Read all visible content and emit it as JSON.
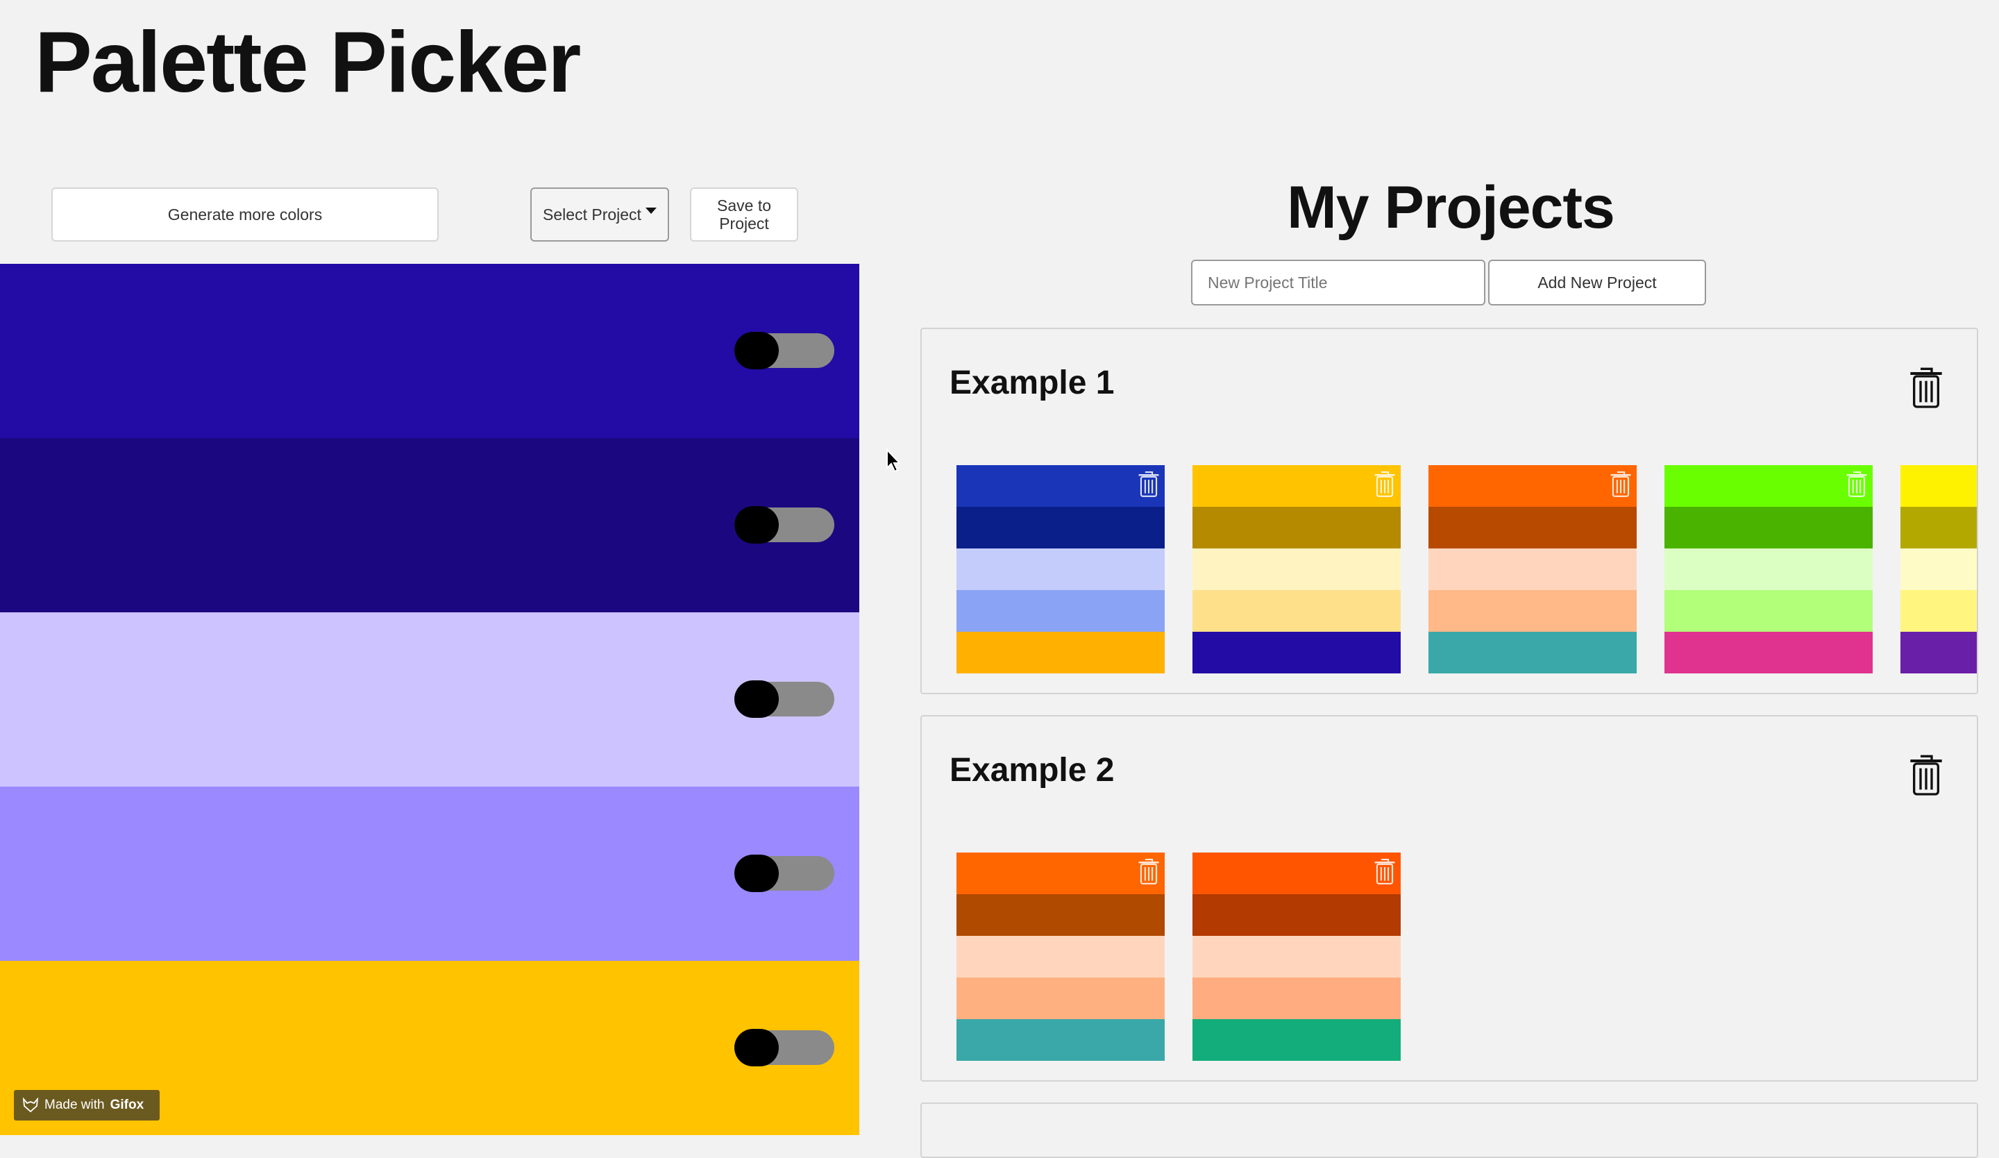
{
  "app": {
    "title": "Palette Picker"
  },
  "controls": {
    "generate_label": "Generate more colors",
    "select_label": "Select Project",
    "save_label": "Save to Project"
  },
  "palette": {
    "colors": [
      "#230ba6",
      "#1b0880",
      "#cdc4ff",
      "#9b89ff",
      "#ffc300"
    ]
  },
  "projects": {
    "title": "My Projects",
    "input_placeholder": "New Project Title",
    "add_label": "Add New Project",
    "items": [
      {
        "name": "Example 1",
        "palettes": [
          [
            "#1a35b8",
            "#0a1f8a",
            "#c3ccfb",
            "#8aa3f4",
            "#ffb000"
          ],
          [
            "#ffc300",
            "#b68a00",
            "#fff3c2",
            "#ffe08a",
            "#230ba6"
          ],
          [
            "#ff6600",
            "#b84a00",
            "#ffd6bd",
            "#ffb888",
            "#3aa8a8"
          ],
          [
            "#6aff00",
            "#4ab300",
            "#dbffc2",
            "#b2ff7a",
            "#e0338f"
          ],
          [
            "#fff200",
            "#b3a800",
            "#fffbc7",
            "#fff57f",
            "#6a1fa8"
          ]
        ]
      },
      {
        "name": "Example 2",
        "palettes": [
          [
            "#ff6600",
            "#b04a00",
            "#ffd6bd",
            "#ffb080",
            "#3aa8a8"
          ],
          [
            "#ff5500",
            "#b33a00",
            "#ffd6bd",
            "#ffac80",
            "#12ad7a"
          ]
        ]
      }
    ]
  },
  "badge": {
    "prefix": "Made with",
    "brand": "Gifox"
  },
  "icons": {
    "trash": "trash-icon",
    "toggle": "lock-toggle"
  }
}
